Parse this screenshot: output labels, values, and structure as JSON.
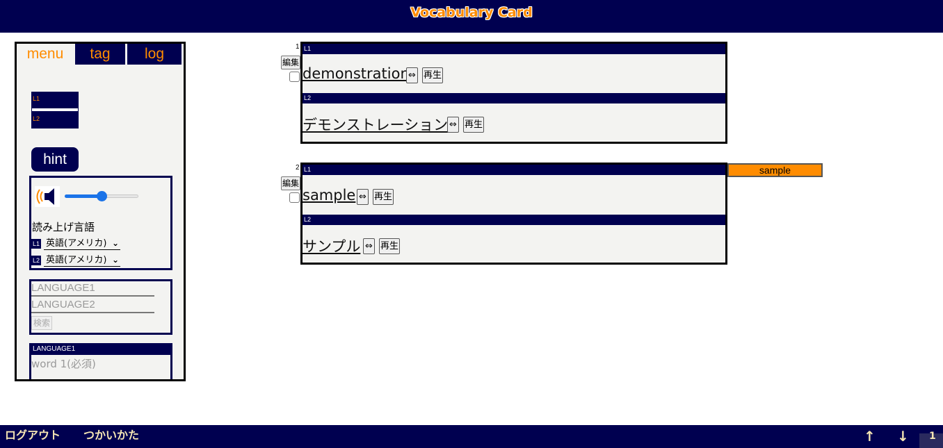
{
  "app": {
    "title": "Vocabulary Card"
  },
  "sidebar": {
    "tabs": [
      {
        "label": "menu",
        "active": true
      },
      {
        "label": "tag",
        "active": false
      },
      {
        "label": "log",
        "active": false
      }
    ],
    "thumbnail": {
      "l1": "L1",
      "l2": "L2"
    },
    "hint_label": "hint",
    "speech": {
      "icon": "speaker-icon",
      "volume_percent": 50,
      "heading": "読み上げ言語",
      "rows": [
        {
          "badge": "L1",
          "value": "英語(アメリカ)"
        },
        {
          "badge": "L2",
          "value": "英語(アメリカ)"
        }
      ]
    },
    "search": {
      "language1_placeholder": "LANGUAGE1",
      "language2_placeholder": "LANGUAGE2",
      "button_label": "検索"
    },
    "add_form": {
      "header": "LANGUAGE1",
      "word_placeholder": "word 1(必須)"
    }
  },
  "cards": [
    {
      "index": "1",
      "edit_label": "編集",
      "l1_header": "L1",
      "l1_word": "demonstration",
      "l2_header": "L2",
      "l2_word": "デモンストレーション",
      "swap_label": "⇔",
      "play_label": "再生"
    },
    {
      "index": "2",
      "edit_label": "編集",
      "l1_header": "L1",
      "l1_word": "sample",
      "l2_header": "L2",
      "l2_word": "サンプル",
      "swap_label": "⇔",
      "play_label": "再生",
      "tag": "sample"
    }
  ],
  "footer": {
    "logout": "ログアウト",
    "howto": "つかいかた",
    "up": "↑",
    "down": "↓",
    "page": "1"
  },
  "colors": {
    "navy": "#000050",
    "accent": "#ff8c00",
    "card_bg": "#f3f3f1"
  }
}
